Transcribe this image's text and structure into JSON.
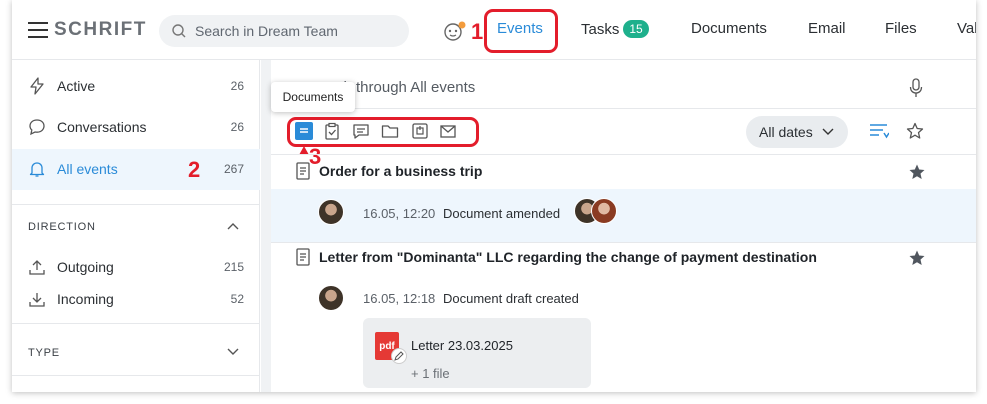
{
  "app": {
    "logo": "SCHRIFT"
  },
  "header": {
    "search_placeholder": "Search in Dream Team",
    "tabs": [
      {
        "label": "Events",
        "active": true
      },
      {
        "label": "Tasks",
        "badge": "15"
      },
      {
        "label": "Documents"
      },
      {
        "label": "Email"
      },
      {
        "label": "Files"
      },
      {
        "label": "Val"
      }
    ]
  },
  "annotations": {
    "one": "1",
    "two": "2",
    "three": "3",
    "color": "#e31d2b"
  },
  "sidebar": {
    "items": [
      {
        "label": "Active",
        "count": "26",
        "icon": "lightning-icon"
      },
      {
        "label": "Conversations",
        "count": "26",
        "icon": "chat-bubble-icon"
      },
      {
        "label": "All events",
        "count": "267",
        "icon": "bell-icon",
        "selected": true
      }
    ],
    "direction": {
      "title": "DIRECTION",
      "items": [
        {
          "label": "Outgoing",
          "count": "215",
          "icon": "upload-icon"
        },
        {
          "label": "Incoming",
          "count": "52",
          "icon": "download-icon"
        }
      ]
    },
    "type": {
      "title": "TYPE"
    }
  },
  "main": {
    "search_text": "Search through All events",
    "search_visible": "rch through All events",
    "tooltip": "Documents",
    "filters": [
      "document-icon",
      "task-clipboard-icon",
      "chat-icon",
      "folder-icon",
      "archive-icon",
      "mail-icon"
    ],
    "date_filter": "All dates",
    "documents": [
      {
        "title": "Order for a business trip",
        "starred": true,
        "events": [
          {
            "time": "16.05, 12:20",
            "text": "Document amended"
          }
        ]
      },
      {
        "title": "Letter from \"Dominanta\" LLC regarding the change of payment destination",
        "starred": true,
        "events": [
          {
            "time": "16.05, 12:18",
            "text": "Document draft created"
          }
        ],
        "attachment": {
          "type": "pdf",
          "name": "Letter 23.03.2025",
          "more": "+ 1 file"
        }
      }
    ]
  },
  "colors": {
    "accent": "#2a8bd8",
    "badge": "#1eb08c",
    "highlight": "#eef6fd"
  }
}
